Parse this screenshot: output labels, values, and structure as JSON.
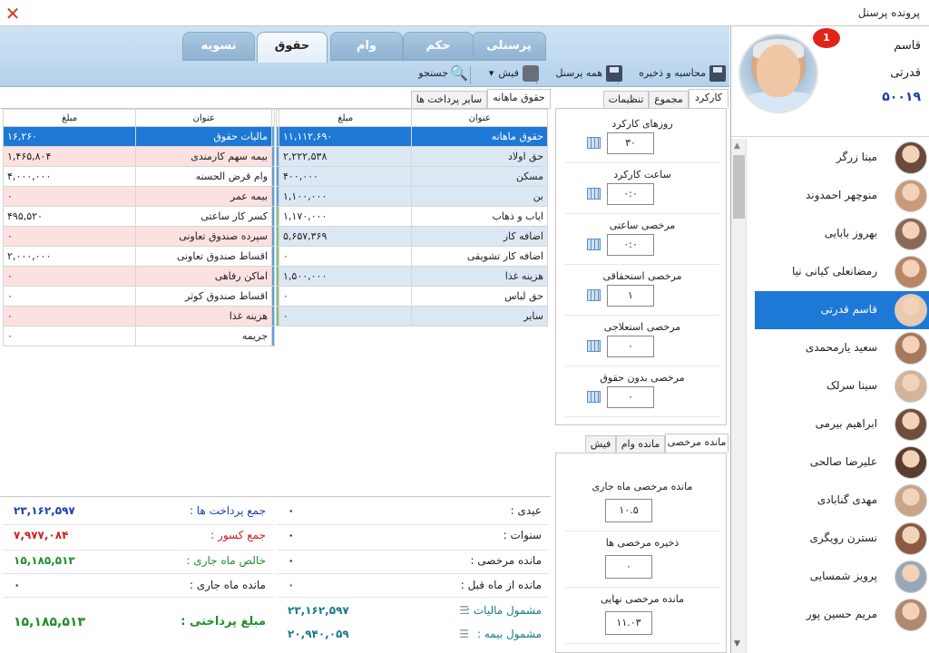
{
  "window": {
    "title": "پرونده پرسنل"
  },
  "profile": {
    "first_name": "قاسم",
    "last_name": "قدرتی",
    "code": "۵۰۰۱۹",
    "badge": "1"
  },
  "people": [
    {
      "name": "مینا زرگر"
    },
    {
      "name": "منوچهر احمدوند"
    },
    {
      "name": "بهروز بابایی"
    },
    {
      "name": "رمضانعلی کیانی نیا"
    },
    {
      "name": "قاسم قدرتی",
      "selected": true
    },
    {
      "name": "سعید یارمحمدی"
    },
    {
      "name": "سینا سرلک"
    },
    {
      "name": "ابراهیم بیرمی"
    },
    {
      "name": "علیرضا صالحی"
    },
    {
      "name": "مهدی گنابادی"
    },
    {
      "name": "نسترن رویگری"
    },
    {
      "name": "پرویز شمسایی"
    },
    {
      "name": "مریم حسین پور"
    }
  ],
  "tabs": [
    "پرسنلی",
    "حکم",
    "وام",
    "حقوق",
    "تسویه"
  ],
  "active_tab": "حقوق",
  "toolbar": {
    "calc_save": "محاسبه و ذخیره",
    "all_personnel": "همه پرسنل",
    "payslip": "فیش",
    "search": "جستجو"
  },
  "left_tabs": {
    "monthly_salary": "حقوق ماهانه",
    "other_payments": "سایر پرداخت ها"
  },
  "earnings_table": {
    "headers": {
      "title": "عنوان",
      "amount": "مبلغ"
    },
    "rows": [
      {
        "title": "حقوق ماهانه",
        "amount": "۱۱,۱۱۲,۶۹۰"
      },
      {
        "title": "حق اولاد",
        "amount": "۲,۲۲۲,۵۳۸"
      },
      {
        "title": "مسکن",
        "amount": "۴۰۰,۰۰۰"
      },
      {
        "title": "بن",
        "amount": "۱,۱۰۰,۰۰۰"
      },
      {
        "title": "ایاب و ذهاب",
        "amount": "۱,۱۷۰,۰۰۰"
      },
      {
        "title": "اضافه کار",
        "amount": "۵,۶۵۷,۳۶۹"
      },
      {
        "title": "اضافه کار تشویقی",
        "amount": "۰"
      },
      {
        "title": "هزینه غذا",
        "amount": "۱,۵۰۰,۰۰۰"
      },
      {
        "title": "حق لباس",
        "amount": "۰"
      },
      {
        "title": "سایر",
        "amount": "۰"
      }
    ]
  },
  "deductions_table": {
    "headers": {
      "title": "عنوان",
      "amount": "مبلغ"
    },
    "rows": [
      {
        "title": "مالیات حقوق",
        "amount": "۱۶,۲۶۰"
      },
      {
        "title": "بیمه سهم کارمندی",
        "amount": "۱,۴۶۵,۸۰۴"
      },
      {
        "title": "وام قرض الحسنه",
        "amount": "۴,۰۰۰,۰۰۰"
      },
      {
        "title": "بیمه عمر",
        "amount": "۰"
      },
      {
        "title": "کسر کار ساعتی",
        "amount": "۴۹۵,۵۲۰"
      },
      {
        "title": "سپرده صندوق تعاونی",
        "amount": "۰"
      },
      {
        "title": "اقساط صندوق تعاونی",
        "amount": "۲,۰۰۰,۰۰۰"
      },
      {
        "title": "اماکن رفاهی",
        "amount": "۰"
      },
      {
        "title": "اقساط صندوق کوثر",
        "amount": "۰"
      },
      {
        "title": "هزینه غذا",
        "amount": "۰"
      },
      {
        "title": "جریمه",
        "amount": "۰"
      }
    ]
  },
  "summary_mid": {
    "eidi": {
      "label": "عیدی :",
      "value": "۰"
    },
    "sanavat": {
      "label": "سنوات :",
      "value": "۰"
    },
    "leave_balance": {
      "label": "مانده مرخصی :",
      "value": "۰"
    },
    "prev_month": {
      "label": "مانده از ماه قبل :",
      "value": "۰"
    },
    "taxable": {
      "label": "مشمول مالیات :",
      "value": "۲۳,۱۶۲,۵۹۷"
    },
    "insurable": {
      "label": "مشمول بیمه :",
      "value": "۲۰,۹۴۰,۰۵۹"
    }
  },
  "summary_left": {
    "total_payments": {
      "label": "جمع پرداخت ها :",
      "value": "۲۳,۱۶۲,۵۹۷"
    },
    "total_deductions": {
      "label": "جمع کسور :",
      "value": "۷,۹۷۷,۰۸۴"
    },
    "net": {
      "label": "خالص ماه جاری :",
      "value": "۱۵,۱۸۵,۵۱۳"
    },
    "current_balance": {
      "label": "مانده ماه جاری :",
      "value": "۰"
    },
    "payable": {
      "label": "مبلغ پرداختی :",
      "value": "۱۵,۱۸۵,۵۱۳"
    }
  },
  "work_tabs": [
    "کارکرد",
    "مجموع",
    "تنظیمات"
  ],
  "work_fields": [
    {
      "label": "روزهای کارکرد",
      "value": "۳۰"
    },
    {
      "label": "ساعت کارکرد",
      "value": "۰:۰"
    },
    {
      "label": "مرخصی ساعتی",
      "value": "۰:۰"
    },
    {
      "label": "مرخصی استحقاقی",
      "value": "۱"
    },
    {
      "label": "مرخصی استعلاجی",
      "value": "۰"
    },
    {
      "label": "مرخصی بدون حقوق",
      "value": "۰"
    }
  ],
  "balance_tabs": [
    "مانده مرخصی",
    "مانده وام",
    "فیش"
  ],
  "balance_fields": [
    {
      "label": "مانده مرخصی ماه جاری",
      "value": "۱۰.۵"
    },
    {
      "label": "ذخیره مرخصی ها",
      "value": "۰"
    },
    {
      "label": "مانده مرخصی نهایی",
      "value": "۱۱.۰۳"
    }
  ],
  "colors": {
    "accent": "#1e78d6",
    "total_payments": "#1a3fb0",
    "total_deductions": "#d0201a",
    "net": "#1f8f2f",
    "taxable": "#1a7a8a"
  }
}
